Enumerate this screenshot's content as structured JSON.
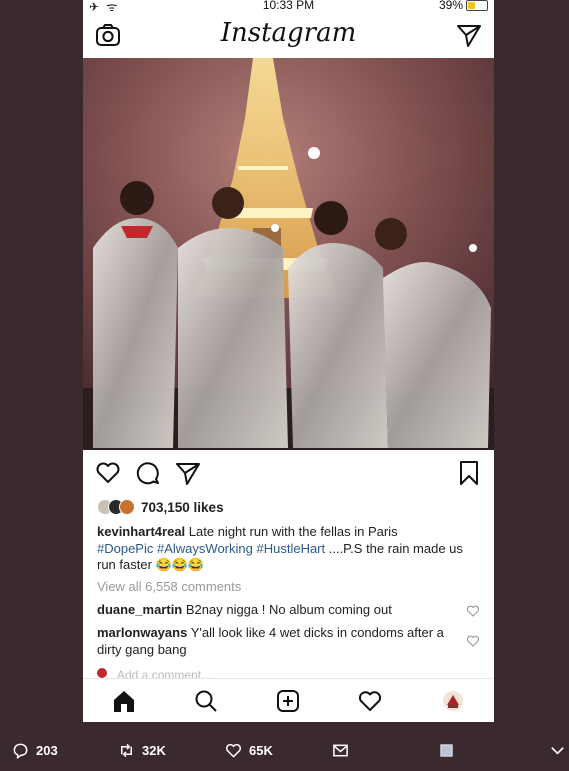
{
  "status": {
    "time": "10:33 PM",
    "battery": "39%",
    "battery_level": 0.39
  },
  "header": {
    "logo": "Instagram"
  },
  "post": {
    "likes": "703,150 likes",
    "caption": {
      "username": "kevinhart4real",
      "text": " Late night run with the fellas in Paris",
      "hashtags": [
        "#DopePic",
        "#AlwaysWorking",
        "#HustleHart"
      ],
      "after_tags": " ....P.S the rain made us run faster 😂😂😂"
    },
    "view_all": "View all 6,558 comments",
    "comments": [
      {
        "username": "duane_martin",
        "text": " B2nay nigga ! No album coming out"
      },
      {
        "username": "marlonwayans",
        "text": " Y'all look like 4 wet dicks in condoms after a dirty gang bang"
      }
    ],
    "add_comment": "Add a comment..."
  },
  "tweet": {
    "replies": "203",
    "retweets": "32K",
    "likes": "65K"
  },
  "icons": {
    "camera": "camera-icon",
    "send": "paper-plane-icon",
    "heart": "heart-icon",
    "comment": "comment-bubble-icon",
    "bookmark": "bookmark-icon",
    "home": "home-icon",
    "search": "search-icon",
    "add": "plus-square-icon",
    "activity": "heart-icon",
    "profile": "avatar-icon",
    "reply": "reply-icon",
    "retweet": "retweet-icon",
    "mail": "mail-icon",
    "chevron": "chevron-down-icon"
  },
  "colors": {
    "hashtag": "#2b5a8c",
    "tweet_bg": "#3a2a2e",
    "battery": "#f4c51b"
  }
}
